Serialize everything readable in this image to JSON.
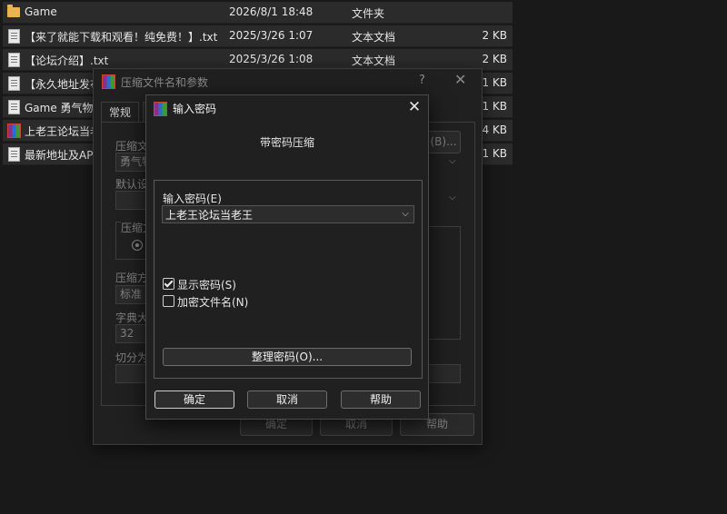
{
  "file_list": {
    "rows": [
      {
        "icon": "folder-icon",
        "name": "Game",
        "date": "2026/8/1 18:48",
        "type": "文件夹",
        "size": ""
      },
      {
        "icon": "text-file-icon",
        "name": "【来了就能下载和观看！纯免费！】.txt",
        "date": "2025/3/26 1:07",
        "type": "文本文档",
        "size": "2 KB"
      },
      {
        "icon": "text-file-icon",
        "name": "【论坛介绍】.txt",
        "date": "2025/3/26 1:08",
        "type": "文本文档",
        "size": "2 KB"
      },
      {
        "icon": "text-file-icon",
        "name": "【永久地址发布",
        "date": "",
        "type": "",
        "size": "1 KB"
      },
      {
        "icon": "file-icon",
        "name": "Game 勇气物语",
        "date": "",
        "type": "",
        "size": "11 KB"
      },
      {
        "icon": "winrar-icon",
        "name": "上老王论坛当老",
        "date": "",
        "type": "",
        "size": "4 KB"
      },
      {
        "icon": "text-file-icon",
        "name": "最新地址及APP",
        "date": "",
        "type": "",
        "size": "1 KB"
      }
    ]
  },
  "archive_dialog": {
    "title": "压缩文件名和参数",
    "help_label": "?",
    "close_label": "✕",
    "tabs": [
      "常规",
      ""
    ],
    "archive_name_label": "压缩文",
    "archive_name_value": "勇气物",
    "browse_label": "(B)...",
    "default_profile_label": "默认设",
    "format_group_label": "压缩文",
    "method_label": "压缩方",
    "method_value": "标准",
    "dictionary_label": "字典大",
    "dictionary_value": "32",
    "split_label": "切分为",
    "ok_label": "确定",
    "cancel_label": "取消",
    "help_button_label": "帮助"
  },
  "password_dialog": {
    "title": "输入密码",
    "close_label": "✕",
    "heading": "带密码压缩",
    "password_label": "输入密码(E)",
    "password_value": "上老王论坛当老王",
    "show_password_label": "显示密码(S)",
    "show_password_checked": true,
    "encrypt_names_label": "加密文件名(N)",
    "encrypt_names_checked": false,
    "organize_button_label": "整理密码(O)...",
    "ok_label": "确定",
    "cancel_label": "取消",
    "help_label": "帮助"
  }
}
